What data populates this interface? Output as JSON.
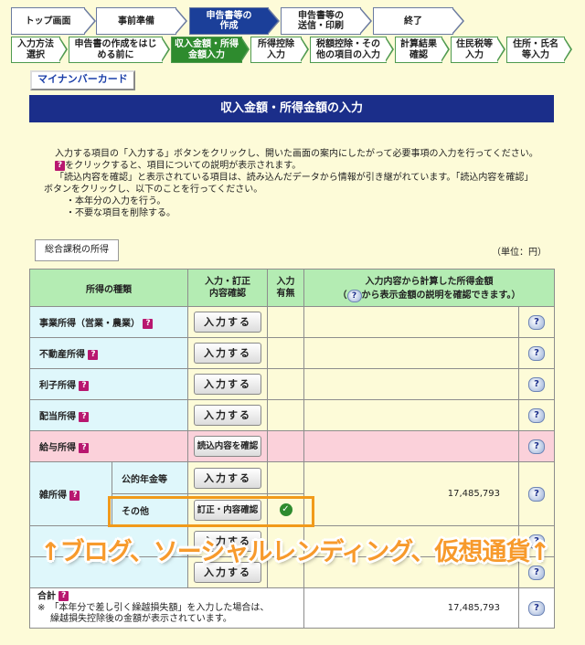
{
  "top_steps": [
    "トップ画面",
    "事前準備",
    "申告書等の\n作成",
    "申告書等の\n送信・印刷",
    "終了"
  ],
  "sub_steps": [
    "入力方法\n選択",
    "申告書の作成をはじ\nめる前に",
    "収入金額・所得\n金額入力",
    "所得控除\n入力",
    "税額控除・その\n他の項目の入力",
    "計算結果\n確認",
    "住民税等\n入力",
    "住所・氏名\n等入力"
  ],
  "mynumber_card": "マイナンバーカード",
  "page_title": "収入金額・所得金額の入力",
  "instructions": {
    "line1": "入力する項目の「入力する」ボタンをクリックし、開いた画面の案内にしたがって必要事項の入力を行ってください。",
    "line2": "をクリックすると、項目についての説明が表示されます。",
    "line3": "「読込内容を確認」と表示されている項目は、読み込んだデータから情報が引き継がれています。「読込内容を確認」",
    "line4": "ボタンをクリックし、以下のことを行ってください。",
    "line5": "・本年分の入力を行う。",
    "line6": "・不要な項目を削除する。"
  },
  "tab_label": "総合課税の所得",
  "unit_label": "（単位：円）",
  "table": {
    "header_kind": "所得の種類",
    "header_input": "入力・訂正\n内容確認",
    "header_status": "入力\n有無",
    "header_amount_line1": "入力内容から計算した所得金額",
    "header_amount_line2": "から表示金額の説明を確認できます。）",
    "header_amount_paren": "（",
    "rows": {
      "business": "事業所得（営業・農業）",
      "realestate": "不動産所得",
      "interest": "利子所得",
      "dividend": "配当所得",
      "salary": "給与所得",
      "misc": "雑所得",
      "misc_pension": "公的年金等",
      "misc_other": "その他",
      "misc_amount": "17,485,793",
      "total": "合計",
      "total_note1": "※　「本年分で差し引く繰越損失額」を入力した場合は、",
      "total_note2": "繰越損失控除後の金額が表示されています。",
      "total_amount": "17,485,793"
    },
    "btn_input": "入力する",
    "btn_read": "読込内容を確認",
    "btn_correct": "訂正・内容確認"
  },
  "overlay_text": "↑ブログ、ソーシャルレンディング、仮想通貨↑"
}
